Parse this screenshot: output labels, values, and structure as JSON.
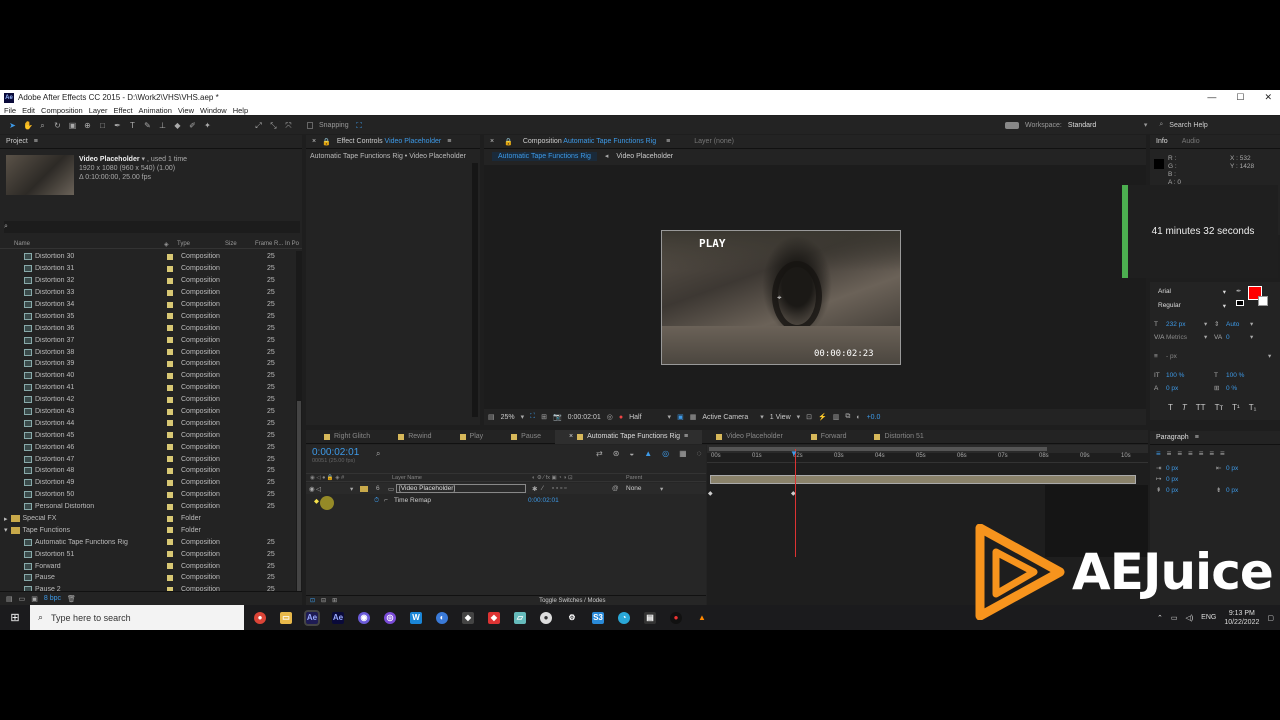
{
  "app": {
    "title": "Adobe After Effects CC 2015 - D:\\Work2\\VHS\\VHS.aep *",
    "window_controls": [
      "—",
      "☐",
      "✕"
    ]
  },
  "menu": [
    "File",
    "Edit",
    "Composition",
    "Layer",
    "Effect",
    "Animation",
    "View",
    "Window",
    "Help"
  ],
  "toolbar": {
    "snapping_label": "Snapping",
    "workspace_label": "Workspace:",
    "workspace_value": "Standard",
    "search_help": "Search Help"
  },
  "project": {
    "tab_label": "Project",
    "item_name": "Video Placeholder",
    "item_used": ", used 1 time",
    "item_size": "1920 x 1080  (960 x 540) (1.00)",
    "item_duration": "Δ 0:10:00:00, 25.00 fps",
    "search_placeholder": "",
    "columns": [
      "Name",
      "Type",
      "Size",
      "Frame R...",
      "In Po"
    ],
    "items": [
      {
        "name": "Distortion 30",
        "type": "Composition",
        "fps": "25",
        "kind": "comp",
        "indent": 1
      },
      {
        "name": "Distortion 31",
        "type": "Composition",
        "fps": "25",
        "kind": "comp",
        "indent": 1
      },
      {
        "name": "Distortion 32",
        "type": "Composition",
        "fps": "25",
        "kind": "comp",
        "indent": 1
      },
      {
        "name": "Distortion 33",
        "type": "Composition",
        "fps": "25",
        "kind": "comp",
        "indent": 1
      },
      {
        "name": "Distortion 34",
        "type": "Composition",
        "fps": "25",
        "kind": "comp",
        "indent": 1
      },
      {
        "name": "Distortion 35",
        "type": "Composition",
        "fps": "25",
        "kind": "comp",
        "indent": 1
      },
      {
        "name": "Distortion 36",
        "type": "Composition",
        "fps": "25",
        "kind": "comp",
        "indent": 1
      },
      {
        "name": "Distortion 37",
        "type": "Composition",
        "fps": "25",
        "kind": "comp",
        "indent": 1
      },
      {
        "name": "Distortion 38",
        "type": "Composition",
        "fps": "25",
        "kind": "comp",
        "indent": 1
      },
      {
        "name": "Distortion 39",
        "type": "Composition",
        "fps": "25",
        "kind": "comp",
        "indent": 1
      },
      {
        "name": "Distortion 40",
        "type": "Composition",
        "fps": "25",
        "kind": "comp",
        "indent": 1
      },
      {
        "name": "Distortion 41",
        "type": "Composition",
        "fps": "25",
        "kind": "comp",
        "indent": 1
      },
      {
        "name": "Distortion 42",
        "type": "Composition",
        "fps": "25",
        "kind": "comp",
        "indent": 1
      },
      {
        "name": "Distortion 43",
        "type": "Composition",
        "fps": "25",
        "kind": "comp",
        "indent": 1
      },
      {
        "name": "Distortion 44",
        "type": "Composition",
        "fps": "25",
        "kind": "comp",
        "indent": 1
      },
      {
        "name": "Distortion 45",
        "type": "Composition",
        "fps": "25",
        "kind": "comp",
        "indent": 1
      },
      {
        "name": "Distortion 46",
        "type": "Composition",
        "fps": "25",
        "kind": "comp",
        "indent": 1
      },
      {
        "name": "Distortion 47",
        "type": "Composition",
        "fps": "25",
        "kind": "comp",
        "indent": 1
      },
      {
        "name": "Distortion 48",
        "type": "Composition",
        "fps": "25",
        "kind": "comp",
        "indent": 1
      },
      {
        "name": "Distortion 49",
        "type": "Composition",
        "fps": "25",
        "kind": "comp",
        "indent": 1
      },
      {
        "name": "Distortion 50",
        "type": "Composition",
        "fps": "25",
        "kind": "comp",
        "indent": 1
      },
      {
        "name": "Personal Distortion",
        "type": "Composition",
        "fps": "25",
        "kind": "comp",
        "indent": 1
      },
      {
        "name": "Special FX",
        "type": "Folder",
        "fps": "",
        "kind": "folder",
        "indent": 0
      },
      {
        "name": "Tape Functions",
        "type": "Folder",
        "fps": "",
        "kind": "folder",
        "indent": 0
      },
      {
        "name": "Automatic Tape Functions Rig",
        "type": "Composition",
        "fps": "25",
        "kind": "comp",
        "indent": 1
      },
      {
        "name": "Distortion 51",
        "type": "Composition",
        "fps": "25",
        "kind": "comp",
        "indent": 1
      },
      {
        "name": "Forward",
        "type": "Composition",
        "fps": "25",
        "kind": "comp",
        "indent": 1
      },
      {
        "name": "Pause",
        "type": "Composition",
        "fps": "25",
        "kind": "comp",
        "indent": 1
      },
      {
        "name": "Pause 2",
        "type": "Composition",
        "fps": "25",
        "kind": "comp",
        "indent": 1
      }
    ],
    "bpc": "8 bpc"
  },
  "effect_controls": {
    "tab_label": "Effect Controls",
    "tab_target": "Video Placeholder",
    "breadcrumb": "Automatic Tape Functions Rig • Video Placeholder"
  },
  "composition": {
    "tab_label": "Composition",
    "tab_target": "Automatic Tape Functions Rig",
    "layer_tab": "Layer  (none)",
    "flow_current": "Automatic Tape Functions Rig",
    "flow_next": "Video Placeholder",
    "overlay_play": "PLAY",
    "overlay_timecode": "00:00:02:23",
    "zoom": "25%",
    "timecode": "0:00:02:01",
    "resolution": "Half",
    "camera": "Active Camera",
    "views": "1 View",
    "exposure": "+0.0"
  },
  "info": {
    "tab_info": "Info",
    "tab_audio": "Audio",
    "r": "R :",
    "g": "G :",
    "b": "B :",
    "a": "A : 0",
    "x": "X : 532",
    "y": "Y : 1428"
  },
  "notification": "41 minutes 32 seconds",
  "character": {
    "font": "Arial",
    "style": "Regular",
    "size": "232 px",
    "leading": "Auto",
    "kerning": "Metrics",
    "tracking": "0",
    "stroke": "- px",
    "vscale": "100 %",
    "hscale": "100 %",
    "baseline": "0 px",
    "tsume": "0 %"
  },
  "paragraph": {
    "tab_label": "Paragraph",
    "indent_values": [
      "0 px",
      "0 px",
      "0 px",
      "0 px",
      "0 px"
    ]
  },
  "timeline": {
    "tabs": [
      {
        "label": "Right Glitch",
        "color": "#d7b85a",
        "active": false
      },
      {
        "label": "Rewind",
        "color": "#d7b85a",
        "active": false
      },
      {
        "label": "Play",
        "color": "#d7b85a",
        "active": false
      },
      {
        "label": "Pause",
        "color": "#d7b85a",
        "active": false
      },
      {
        "label": "Automatic Tape Functions Rig",
        "color": "#d7b85a",
        "active": true
      },
      {
        "label": "Video Placeholder",
        "color": "#d7b85a",
        "active": false
      },
      {
        "label": "Forward",
        "color": "#d7b85a",
        "active": false
      },
      {
        "label": "Distortion 51",
        "color": "#d7b85a",
        "active": false
      }
    ],
    "timecode": "0:00:02:01",
    "frame_info": "00051 (25.00 fps)",
    "col_layer_name": "Layer Name",
    "col_parent": "Parent",
    "layer_num": "6",
    "layer_name": "[Video Placeholder]",
    "parent_value": "None",
    "property_name": "Time Remap",
    "property_value": "0:00:02:01",
    "ruler": [
      "00s",
      "01s",
      "02s",
      "03s",
      "04s",
      "05s",
      "06s",
      "07s",
      "08s",
      "09s",
      "10s"
    ],
    "toggle_label": "Toggle Switches / Modes"
  },
  "watermark": "AEJuice",
  "taskbar": {
    "search_placeholder": "Type here to search",
    "lang": "ENG",
    "time": "9:13 PM",
    "date": "10/22/2022"
  }
}
